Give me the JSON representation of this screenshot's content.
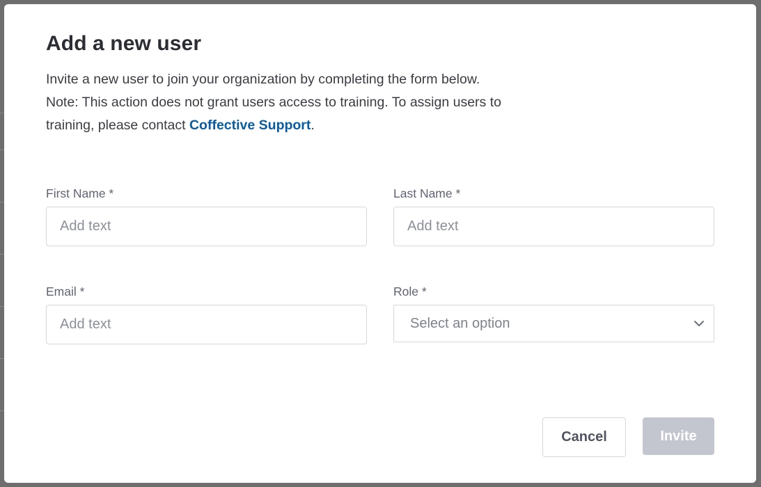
{
  "modal": {
    "title": "Add a new user",
    "description_line": "Invite a new user to join your organization by completing the form below.",
    "note_text": "Note: This action does not grant users access to training. To assign users to training, please contact ",
    "support_link": "Coffective Support",
    "note_end": "."
  },
  "form": {
    "first_name": {
      "label": "First Name *",
      "placeholder": "Add text",
      "value": ""
    },
    "last_name": {
      "label": "Last Name *",
      "placeholder": "Add text",
      "value": ""
    },
    "email": {
      "label": "Email *",
      "placeholder": "Add text",
      "value": ""
    },
    "role": {
      "label": "Role *",
      "selected": "Select an option"
    }
  },
  "actions": {
    "cancel_label": "Cancel",
    "invite_label": "Invite"
  },
  "icons": {
    "role_dropdown": "chevron-down-icon"
  },
  "colors": {
    "link": "#0a5c9e",
    "invite_disabled_bg": "#c3c6cf",
    "overlay": "#6e6e6e"
  }
}
